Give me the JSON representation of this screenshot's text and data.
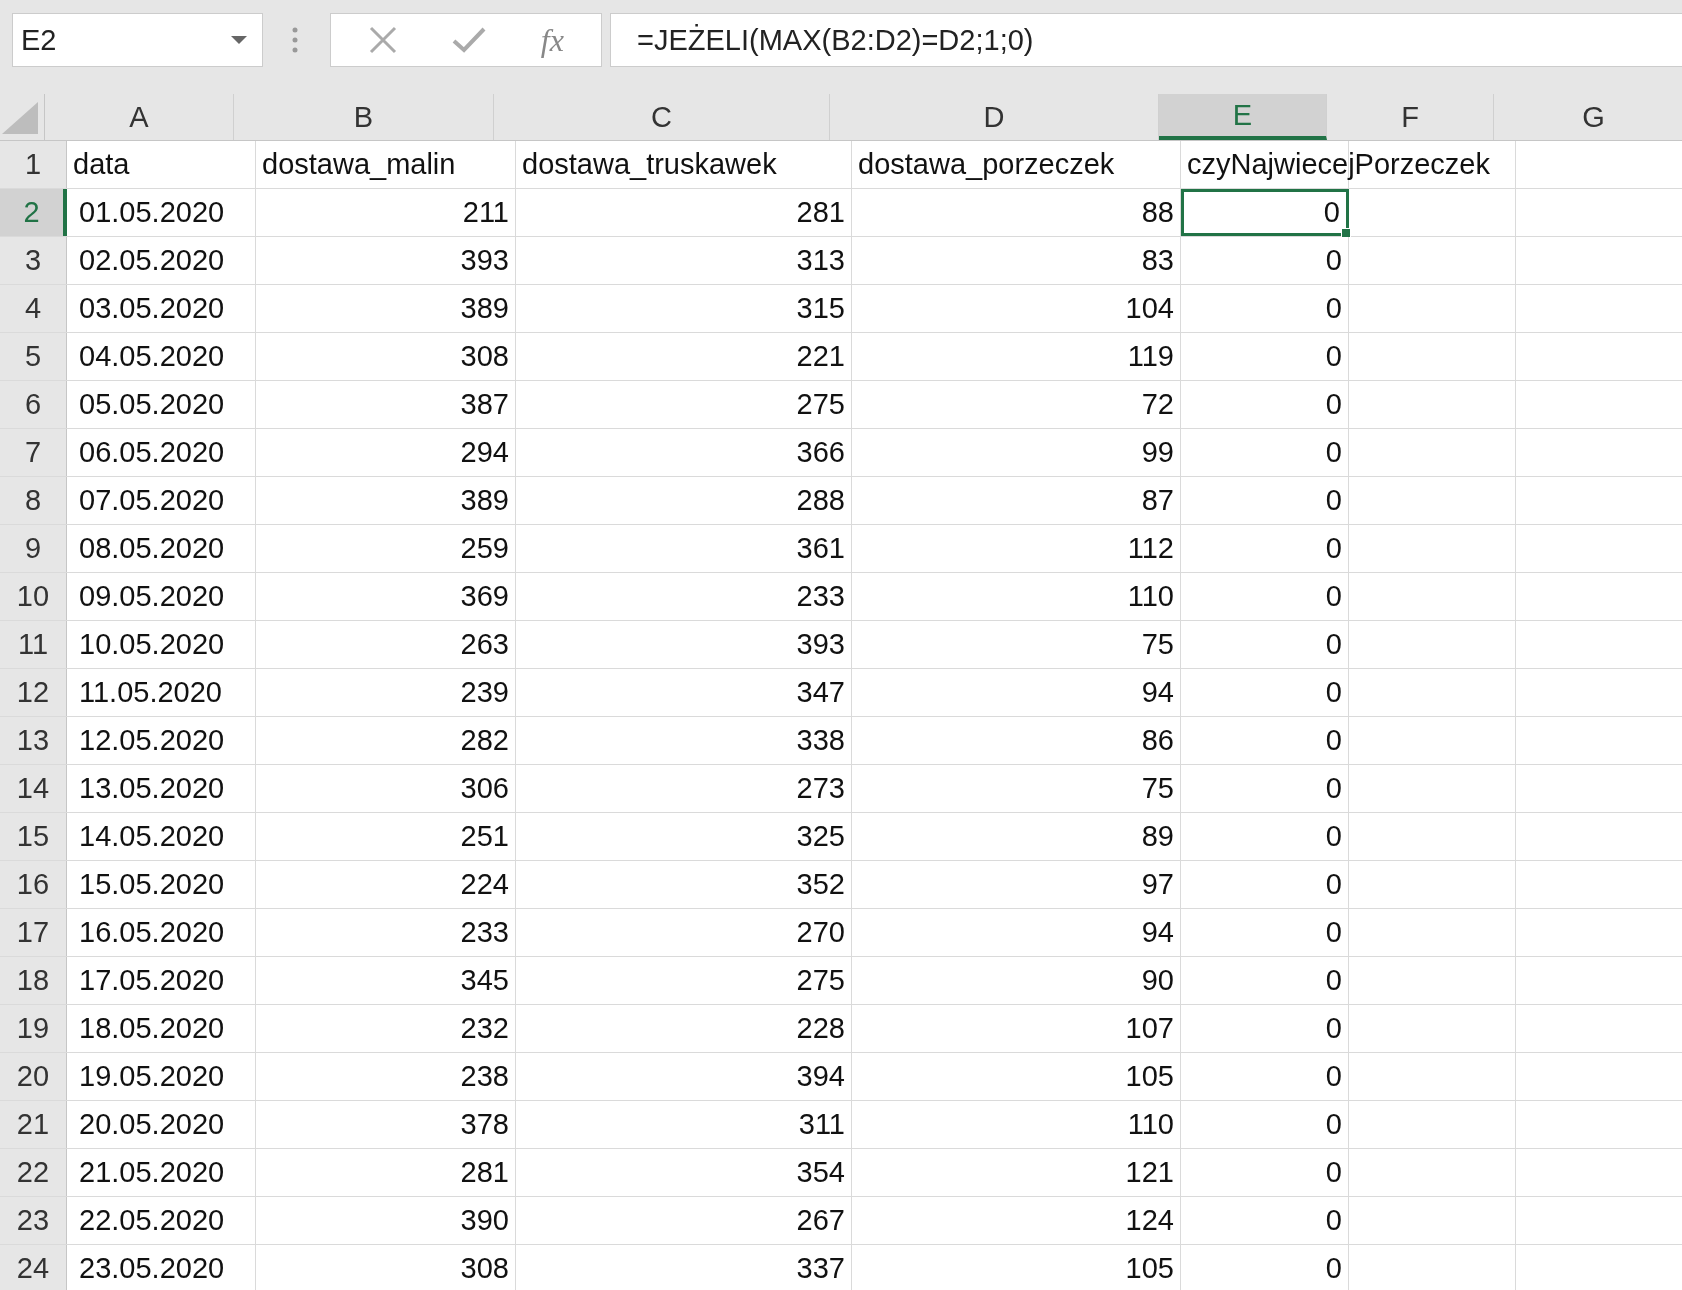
{
  "formula_bar": {
    "name_box": "E2",
    "fx_label": "fx",
    "formula": "=JEŻELI(MAX(B2:D2)=D2;1;0)"
  },
  "columns": [
    {
      "label": "A",
      "selected": false
    },
    {
      "label": "B",
      "selected": false
    },
    {
      "label": "C",
      "selected": false
    },
    {
      "label": "D",
      "selected": false
    },
    {
      "label": "E",
      "selected": true
    },
    {
      "label": "F",
      "selected": false
    },
    {
      "label": "G",
      "selected": false
    }
  ],
  "rows": [
    {
      "number": "1",
      "selected": false,
      "kind": "header",
      "cells": [
        "data",
        "dostawa_malin",
        "dostawa_truskawek",
        "dostawa_porzeczek",
        "czyNajwiecejPorzeczek"
      ]
    },
    {
      "number": "2",
      "selected": true,
      "kind": "data",
      "cells": [
        "01.05.2020",
        "211",
        "281",
        "88",
        "0"
      ]
    },
    {
      "number": "3",
      "selected": false,
      "kind": "data",
      "cells": [
        "02.05.2020",
        "393",
        "313",
        "83",
        "0"
      ]
    },
    {
      "number": "4",
      "selected": false,
      "kind": "data",
      "cells": [
        "03.05.2020",
        "389",
        "315",
        "104",
        "0"
      ]
    },
    {
      "number": "5",
      "selected": false,
      "kind": "data",
      "cells": [
        "04.05.2020",
        "308",
        "221",
        "119",
        "0"
      ]
    },
    {
      "number": "6",
      "selected": false,
      "kind": "data",
      "cells": [
        "05.05.2020",
        "387",
        "275",
        "72",
        "0"
      ]
    },
    {
      "number": "7",
      "selected": false,
      "kind": "data",
      "cells": [
        "06.05.2020",
        "294",
        "366",
        "99",
        "0"
      ]
    },
    {
      "number": "8",
      "selected": false,
      "kind": "data",
      "cells": [
        "07.05.2020",
        "389",
        "288",
        "87",
        "0"
      ]
    },
    {
      "number": "9",
      "selected": false,
      "kind": "data",
      "cells": [
        "08.05.2020",
        "259",
        "361",
        "112",
        "0"
      ]
    },
    {
      "number": "10",
      "selected": false,
      "kind": "data",
      "cells": [
        "09.05.2020",
        "369",
        "233",
        "110",
        "0"
      ]
    },
    {
      "number": "11",
      "selected": false,
      "kind": "data",
      "cells": [
        "10.05.2020",
        "263",
        "393",
        "75",
        "0"
      ]
    },
    {
      "number": "12",
      "selected": false,
      "kind": "data",
      "cells": [
        "11.05.2020",
        "239",
        "347",
        "94",
        "0"
      ]
    },
    {
      "number": "13",
      "selected": false,
      "kind": "data",
      "cells": [
        "12.05.2020",
        "282",
        "338",
        "86",
        "0"
      ]
    },
    {
      "number": "14",
      "selected": false,
      "kind": "data",
      "cells": [
        "13.05.2020",
        "306",
        "273",
        "75",
        "0"
      ]
    },
    {
      "number": "15",
      "selected": false,
      "kind": "data",
      "cells": [
        "14.05.2020",
        "251",
        "325",
        "89",
        "0"
      ]
    },
    {
      "number": "16",
      "selected": false,
      "kind": "data",
      "cells": [
        "15.05.2020",
        "224",
        "352",
        "97",
        "0"
      ]
    },
    {
      "number": "17",
      "selected": false,
      "kind": "data",
      "cells": [
        "16.05.2020",
        "233",
        "270",
        "94",
        "0"
      ]
    },
    {
      "number": "18",
      "selected": false,
      "kind": "data",
      "cells": [
        "17.05.2020",
        "345",
        "275",
        "90",
        "0"
      ]
    },
    {
      "number": "19",
      "selected": false,
      "kind": "data",
      "cells": [
        "18.05.2020",
        "232",
        "228",
        "107",
        "0"
      ]
    },
    {
      "number": "20",
      "selected": false,
      "kind": "data",
      "cells": [
        "19.05.2020",
        "238",
        "394",
        "105",
        "0"
      ]
    },
    {
      "number": "21",
      "selected": false,
      "kind": "data",
      "cells": [
        "20.05.2020",
        "378",
        "311",
        "110",
        "0"
      ]
    },
    {
      "number": "22",
      "selected": false,
      "kind": "data",
      "cells": [
        "21.05.2020",
        "281",
        "354",
        "121",
        "0"
      ]
    },
    {
      "number": "23",
      "selected": false,
      "kind": "data",
      "cells": [
        "22.05.2020",
        "390",
        "267",
        "124",
        "0"
      ]
    },
    {
      "number": "24",
      "selected": false,
      "kind": "data",
      "cells": [
        "23.05.2020",
        "308",
        "337",
        "105",
        "0"
      ]
    }
  ]
}
